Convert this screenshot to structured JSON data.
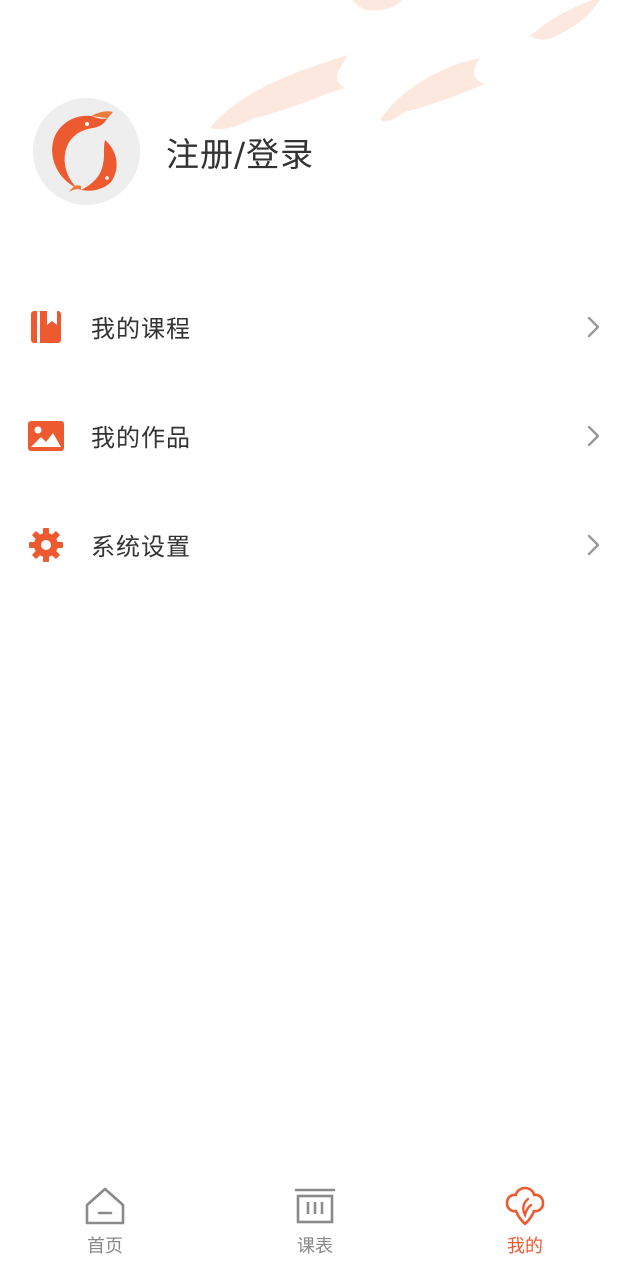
{
  "profile": {
    "login_label": "注册/登录"
  },
  "menu": {
    "items": [
      {
        "label": "我的课程",
        "icon": "course-book-icon"
      },
      {
        "label": "我的作品",
        "icon": "picture-icon"
      },
      {
        "label": "系统设置",
        "icon": "gear-icon"
      }
    ]
  },
  "tabbar": {
    "tabs": [
      {
        "label": "首页",
        "icon": "home-icon",
        "active": false
      },
      {
        "label": "课表",
        "icon": "schedule-icon",
        "active": false
      },
      {
        "label": "我的",
        "icon": "profile-fish-icon",
        "active": true
      }
    ]
  },
  "colors": {
    "accent": "#ee5a30",
    "text": "#333333",
    "inactive": "#8a8a8a",
    "chevron": "#999999"
  }
}
